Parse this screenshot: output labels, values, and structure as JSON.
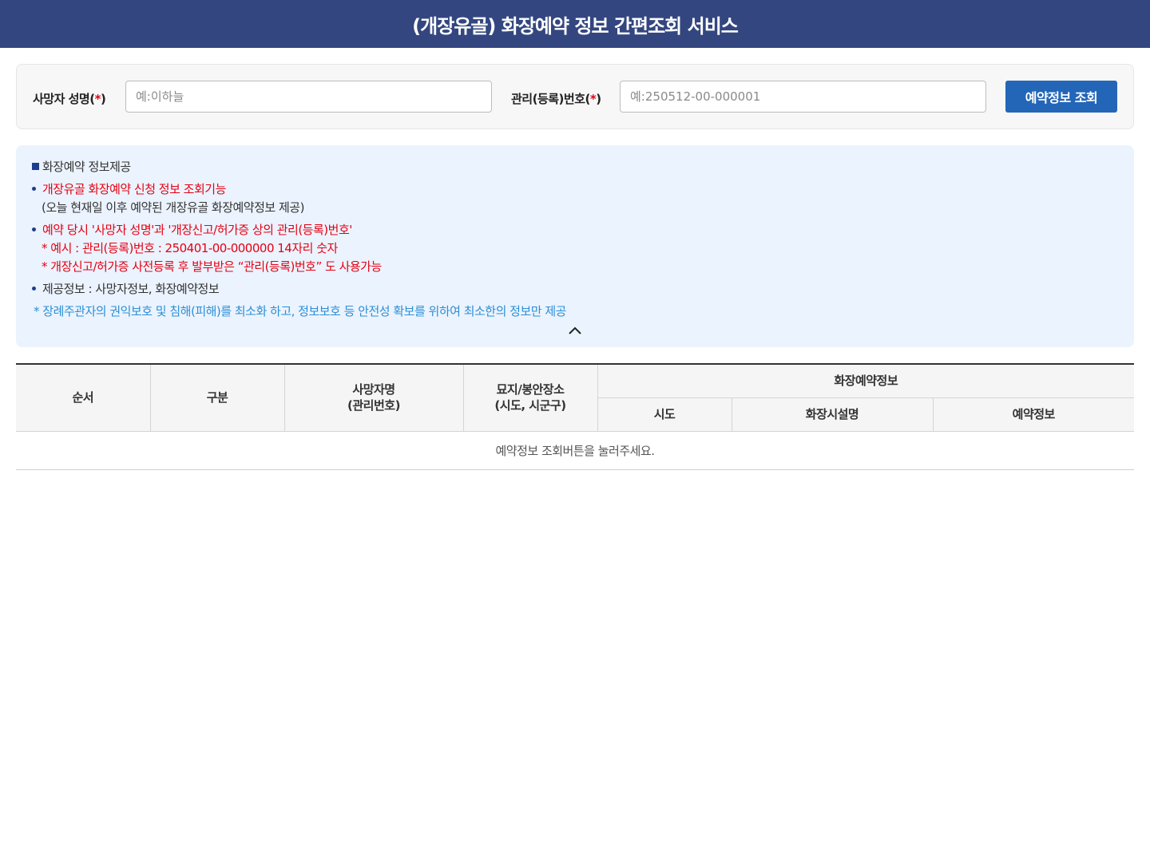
{
  "header": {
    "title": "(개장유골) 화장예약 정보 간편조회 서비스"
  },
  "search": {
    "name_label": "사망자 성명",
    "name_placeholder": "예:이하늘",
    "id_label": "관리(등록)번호",
    "id_placeholder": "예:250512-00-000001",
    "required_mark": "*",
    "button_label": "예약정보 조회"
  },
  "info": {
    "heading": "화장예약 정보제공",
    "line1": "개장유골 화장예약 신청 정보 조회기능",
    "line1_sub": "(오늘 현재일 이후 예약된 개장유골 화장예약정보 제공)",
    "line2": "예약 당시 '사망자 성명'과 '개장신고/허가증 상의 관리(등록)번호'",
    "line2_ex1": "* 예시 : 관리(등록)번호 : 250401-00-000000 14자리 숫자",
    "line2_ex2": "* 개장신고/허가증 사전등록 후 발부받은 “관리(등록)번호” 도 사용가능",
    "line3": "제공정보 : 사망자정보, 화장예약정보",
    "note": "* 장례주관자의 권익보호 및 침해(피해)를 최소화 하고, 정보보호 등 안전성 확보를 위하여 최소한의 정보만 제공",
    "collapse_icon": "chevron-up-icon"
  },
  "table": {
    "col_order": "순서",
    "col_type": "구분",
    "col_name_line1": "사망자명",
    "col_name_line2": "(관리번호)",
    "col_place_line1": "묘지/봉안장소",
    "col_place_line2": "(시도, 시군구)",
    "group": "화장예약정보",
    "sub_region": "시도",
    "sub_facility": "화장시설명",
    "sub_reservation": "예약정보",
    "empty_message": "예약정보 조회버튼을 눌러주세요."
  },
  "colors": {
    "header_bg": "#33467f",
    "button_bg": "#2366b8",
    "info_bg": "#ebf3fe",
    "required": "#e60012",
    "note": "#2b8fd6"
  }
}
